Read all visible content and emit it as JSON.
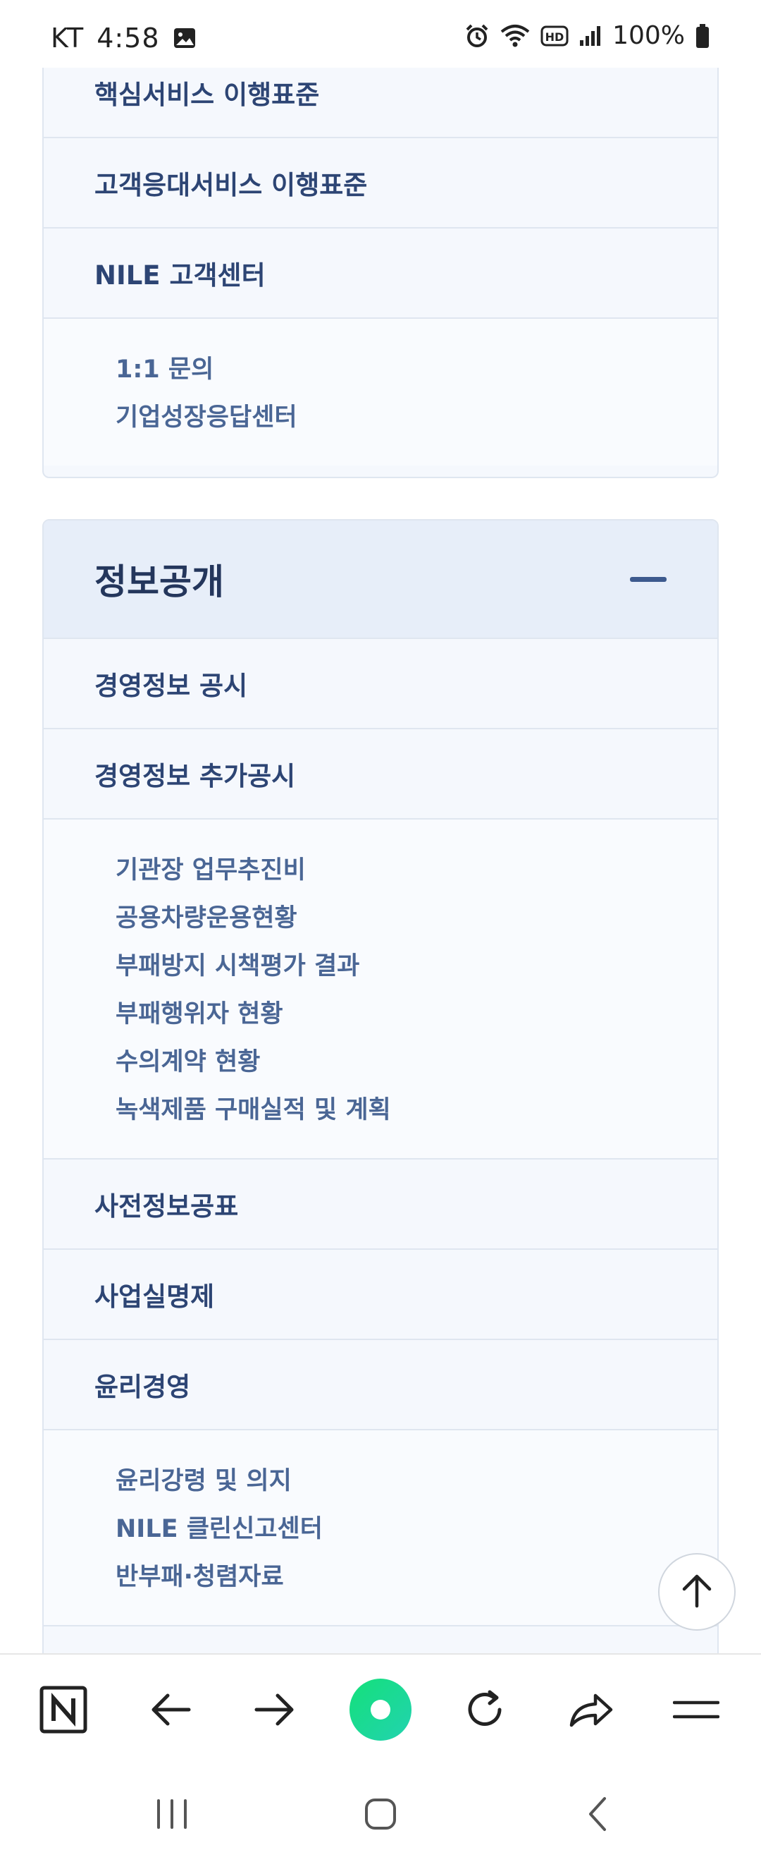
{
  "status_bar": {
    "carrier": "KT",
    "time": "4:58",
    "battery": "100%"
  },
  "menu_top": {
    "items": [
      {
        "label": "핵심서비스 이행표준"
      },
      {
        "label": "고객응대서비스 이행표준"
      },
      {
        "label": "NILE 고객센터"
      }
    ],
    "sub_items": [
      {
        "label": "1:1 문의"
      },
      {
        "label": "기업성장응답센터"
      }
    ]
  },
  "info_section": {
    "title": "정보공개",
    "items": [
      {
        "label": "경영정보 공시"
      },
      {
        "label": "경영정보 추가공시"
      }
    ],
    "sub_items_1": [
      {
        "label": "기관장 업무추진비"
      },
      {
        "label": "공용차량운용현황"
      },
      {
        "label": "부패방지 시책평가 결과"
      },
      {
        "label": "부패행위자 현황"
      },
      {
        "label": "수의계약 현황"
      },
      {
        "label": "녹색제품 구매실적 및 계획"
      }
    ],
    "items_2": [
      {
        "label": "사전정보공표"
      },
      {
        "label": "사업실명제"
      },
      {
        "label": "윤리경영"
      }
    ],
    "sub_items_2": [
      {
        "label": "윤리강령 및 의지"
      },
      {
        "label": "NILE 클린신고센터"
      },
      {
        "label": "반부패·청렴자료"
      }
    ]
  },
  "browser_toolbar": {
    "icons": [
      "naver-n-icon",
      "back-arrow-icon",
      "forward-arrow-icon",
      "green-home-icon",
      "refresh-icon",
      "share-icon",
      "menu-icon"
    ],
    "accent": "#1ee88a"
  }
}
